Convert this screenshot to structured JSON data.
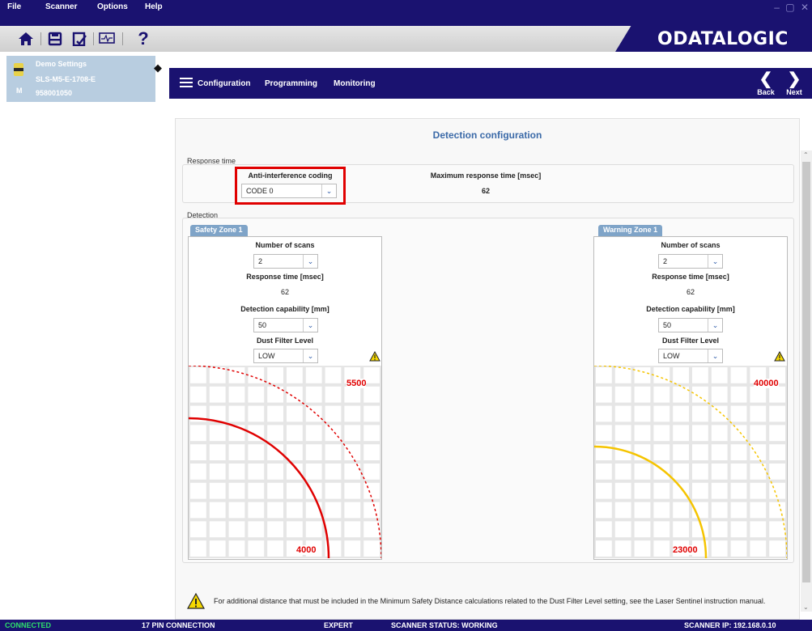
{
  "menu": {
    "file": "File",
    "scanner": "Scanner",
    "options": "Options",
    "help": "Help"
  },
  "window": {
    "minimize": "–",
    "restore": "▢",
    "close": "✕"
  },
  "toolbar": {
    "help_label": "?"
  },
  "brand": {
    "logo_text": "ODATALOGIC",
    "brand_color": "#1a1270"
  },
  "device": {
    "name": "Demo Settings",
    "model": "SLS-M5-E-1708-E",
    "badge": "M",
    "serial": "958001050"
  },
  "nav": {
    "configuration": "Configuration",
    "programming": "Programming",
    "monitoring": "Monitoring",
    "back": "Back",
    "next": "Next"
  },
  "page": {
    "title": "Detection configuration"
  },
  "response_time": {
    "section": "Response time",
    "coding_label": "Anti-interference coding",
    "coding_value": "CODE 0",
    "max_label": "Maximum response time [msec]",
    "max_value": "62"
  },
  "detection": {
    "section": "Detection",
    "zones": [
      {
        "tab": "Safety Zone 1",
        "scans_label": "Number of scans",
        "scans_value": "2",
        "resp_label": "Response time [msec]",
        "resp_value": "62",
        "cap_label": "Detection capability [mm]",
        "cap_value": "50",
        "dust_label": "Dust Filter Level",
        "dust_value": "LOW",
        "outer_value": "5500",
        "inner_value": "4000",
        "color": "#e00000"
      },
      {
        "tab": "Warning Zone 1",
        "scans_label": "Number of scans",
        "scans_value": "2",
        "resp_label": "Response time [msec]",
        "resp_value": "62",
        "cap_label": "Detection capability [mm]",
        "cap_value": "50",
        "dust_label": "Dust Filter Level",
        "dust_value": "LOW",
        "outer_value": "40000",
        "inner_value": "23000",
        "color": "#f5c400"
      }
    ]
  },
  "note": "For additional distance that must be included in the Minimum Safety Distance calculations related to the Dust Filter Level setting, see the Laser Sentinel instruction manual.",
  "status": {
    "connected": "CONNECTED",
    "connection": "17 PIN CONNECTION",
    "mode": "EXPERT",
    "scanner_status": "SCANNER STATUS: WORKING",
    "ip": "SCANNER IP: 192.168.0.10"
  }
}
